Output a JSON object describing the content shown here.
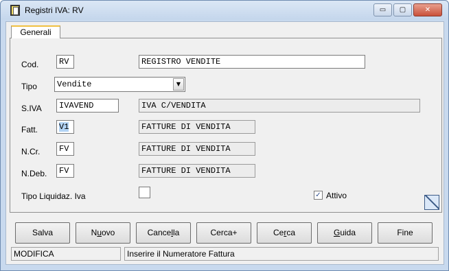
{
  "window": {
    "title": "Registri IVA: RV",
    "controls": {
      "minimize": "▭",
      "maximize": "▢",
      "close": "✕"
    }
  },
  "tabs": [
    {
      "label": "Generali"
    }
  ],
  "form": {
    "cod": {
      "label": "Cod.",
      "value": "RV",
      "description": "REGISTRO VENDITE"
    },
    "tipo": {
      "label": "Tipo",
      "selected": "Vendite"
    },
    "siva": {
      "label": "S.IVA",
      "value": "IVAVEND",
      "description": "IVA C/VENDITA"
    },
    "fatt": {
      "label": "Fatt.",
      "value": "V1",
      "description": "FATTURE DI VENDITA"
    },
    "ncr": {
      "label": "N.Cr.",
      "value": "FV",
      "description": "FATTURE DI VENDITA"
    },
    "ndeb": {
      "label": "N.Deb.",
      "value": "FV",
      "description": "FATTURE DI VENDITA"
    },
    "tipo_liquidaz": {
      "label": "Tipo Liquidaz. Iva",
      "checked": false
    },
    "attivo": {
      "label": "Attivo",
      "checked": true,
      "mark": "✓"
    }
  },
  "buttons": {
    "salva": {
      "pre": "Salva",
      "u": "",
      "post": ""
    },
    "nuovo": {
      "pre": "N",
      "u": "u",
      "post": "ovo"
    },
    "cancella": {
      "pre": "Cance",
      "u": "l",
      "post": "la"
    },
    "cercaplus": {
      "pre": "Cerca+",
      "u": "",
      "post": ""
    },
    "cerca": {
      "pre": "Ce",
      "u": "r",
      "post": "ca"
    },
    "guida": {
      "pre": "",
      "u": "G",
      "post": "uida"
    },
    "fine": {
      "pre": "Fine",
      "u": "",
      "post": ""
    }
  },
  "status": {
    "mode": "MODIFICA",
    "message": "Inserire il Numeratore Fattura"
  },
  "icons": {
    "app": "registry-book-icon",
    "corner": "resize-corner-icon",
    "combo_arrow": "▼"
  }
}
